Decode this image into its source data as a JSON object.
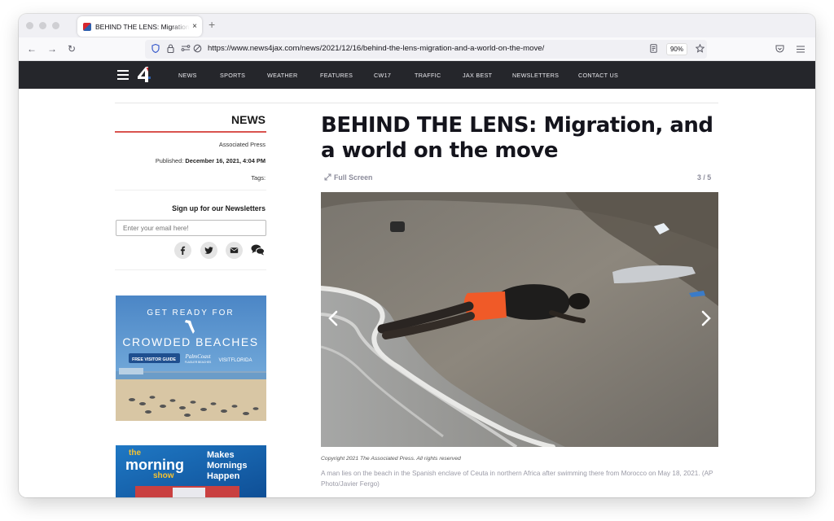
{
  "browser": {
    "tab_title": "BEHIND THE LENS: Migration, and a world on the move",
    "tab_close": "×",
    "new_tab": "+",
    "url": "https://www.news4jax.com/news/2021/12/16/behind-the-lens-migration-and-a-world-on-the-move/",
    "zoom": "90%"
  },
  "site_nav": {
    "links": [
      "NEWS",
      "SPORTS",
      "WEATHER",
      "FEATURES",
      "CW17",
      "TRAFFIC",
      "JAX BEST",
      "NEWSLETTERS",
      "CONTACT US"
    ]
  },
  "sidebar": {
    "section": "NEWS",
    "author": "Associated Press",
    "published_label": "Published:",
    "published_date": "December 16, 2021, 4:04 PM",
    "tags_label": "Tags:",
    "signup_title": "Sign up for our Newsletters",
    "email_placeholder": "Enter your email here!"
  },
  "ads": {
    "beach": {
      "line1": "GET READY FOR",
      "line2": "CROWDED BEACHES",
      "button": "FREE VISITOR GUIDE",
      "brand1": "PalmCoast",
      "brand1_sub": "FLAGLER BEACHES",
      "brand2": "VISITFLORIDA"
    },
    "morning": {
      "the": "the",
      "morning": "morning",
      "show": "show",
      "tagline1": "Makes",
      "tagline2": "Mornings",
      "tagline3": "Happen"
    }
  },
  "article": {
    "headline": "BEHIND THE LENS: Migration, and a world on the move",
    "fullscreen_label": "Full Screen",
    "counter": "3 / 5",
    "copyright": "Copyright 2021 The Associated Press. All rights reserved",
    "caption": "A man lies on the beach in the Spanish enclave of Ceuta in northern Africa after swimming there from Morocco on May 18, 2021. (AP Photo/Javier Fergo)"
  },
  "colors": {
    "site_nav_bg": "#25262b",
    "section_underline": "#d9534f",
    "headline": "#14141c"
  }
}
